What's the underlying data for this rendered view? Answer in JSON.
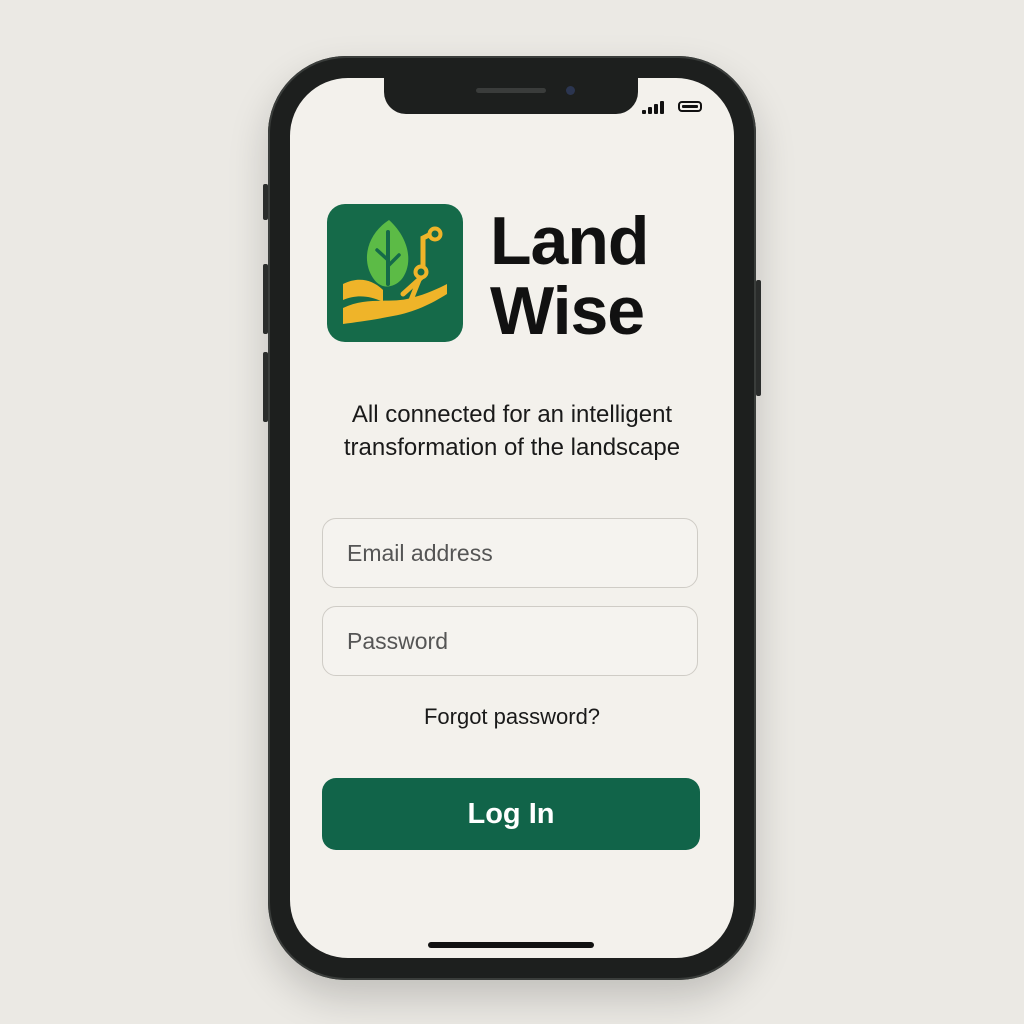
{
  "device": {
    "status_bar": {
      "signal_icon": "signal-bars-icon",
      "battery_icon": "battery-full-icon"
    }
  },
  "app": {
    "logo_icon": "leaf-circuit-logo-icon",
    "brand_line_1": "Land",
    "brand_line_2": "Wise",
    "tagline_line_1": "All connected for an intelligent",
    "tagline_line_2": "transformation of the landscape"
  },
  "login_form": {
    "email_placeholder": "Email address",
    "password_placeholder": "Password",
    "forgot_password_label": "Forgot password?",
    "login_button_label": "Log In"
  },
  "colors": {
    "primary_green": "#116449",
    "logo_leaf_green": "#5cbb46",
    "logo_gold": "#efb429",
    "background": "#f3f1ec"
  }
}
